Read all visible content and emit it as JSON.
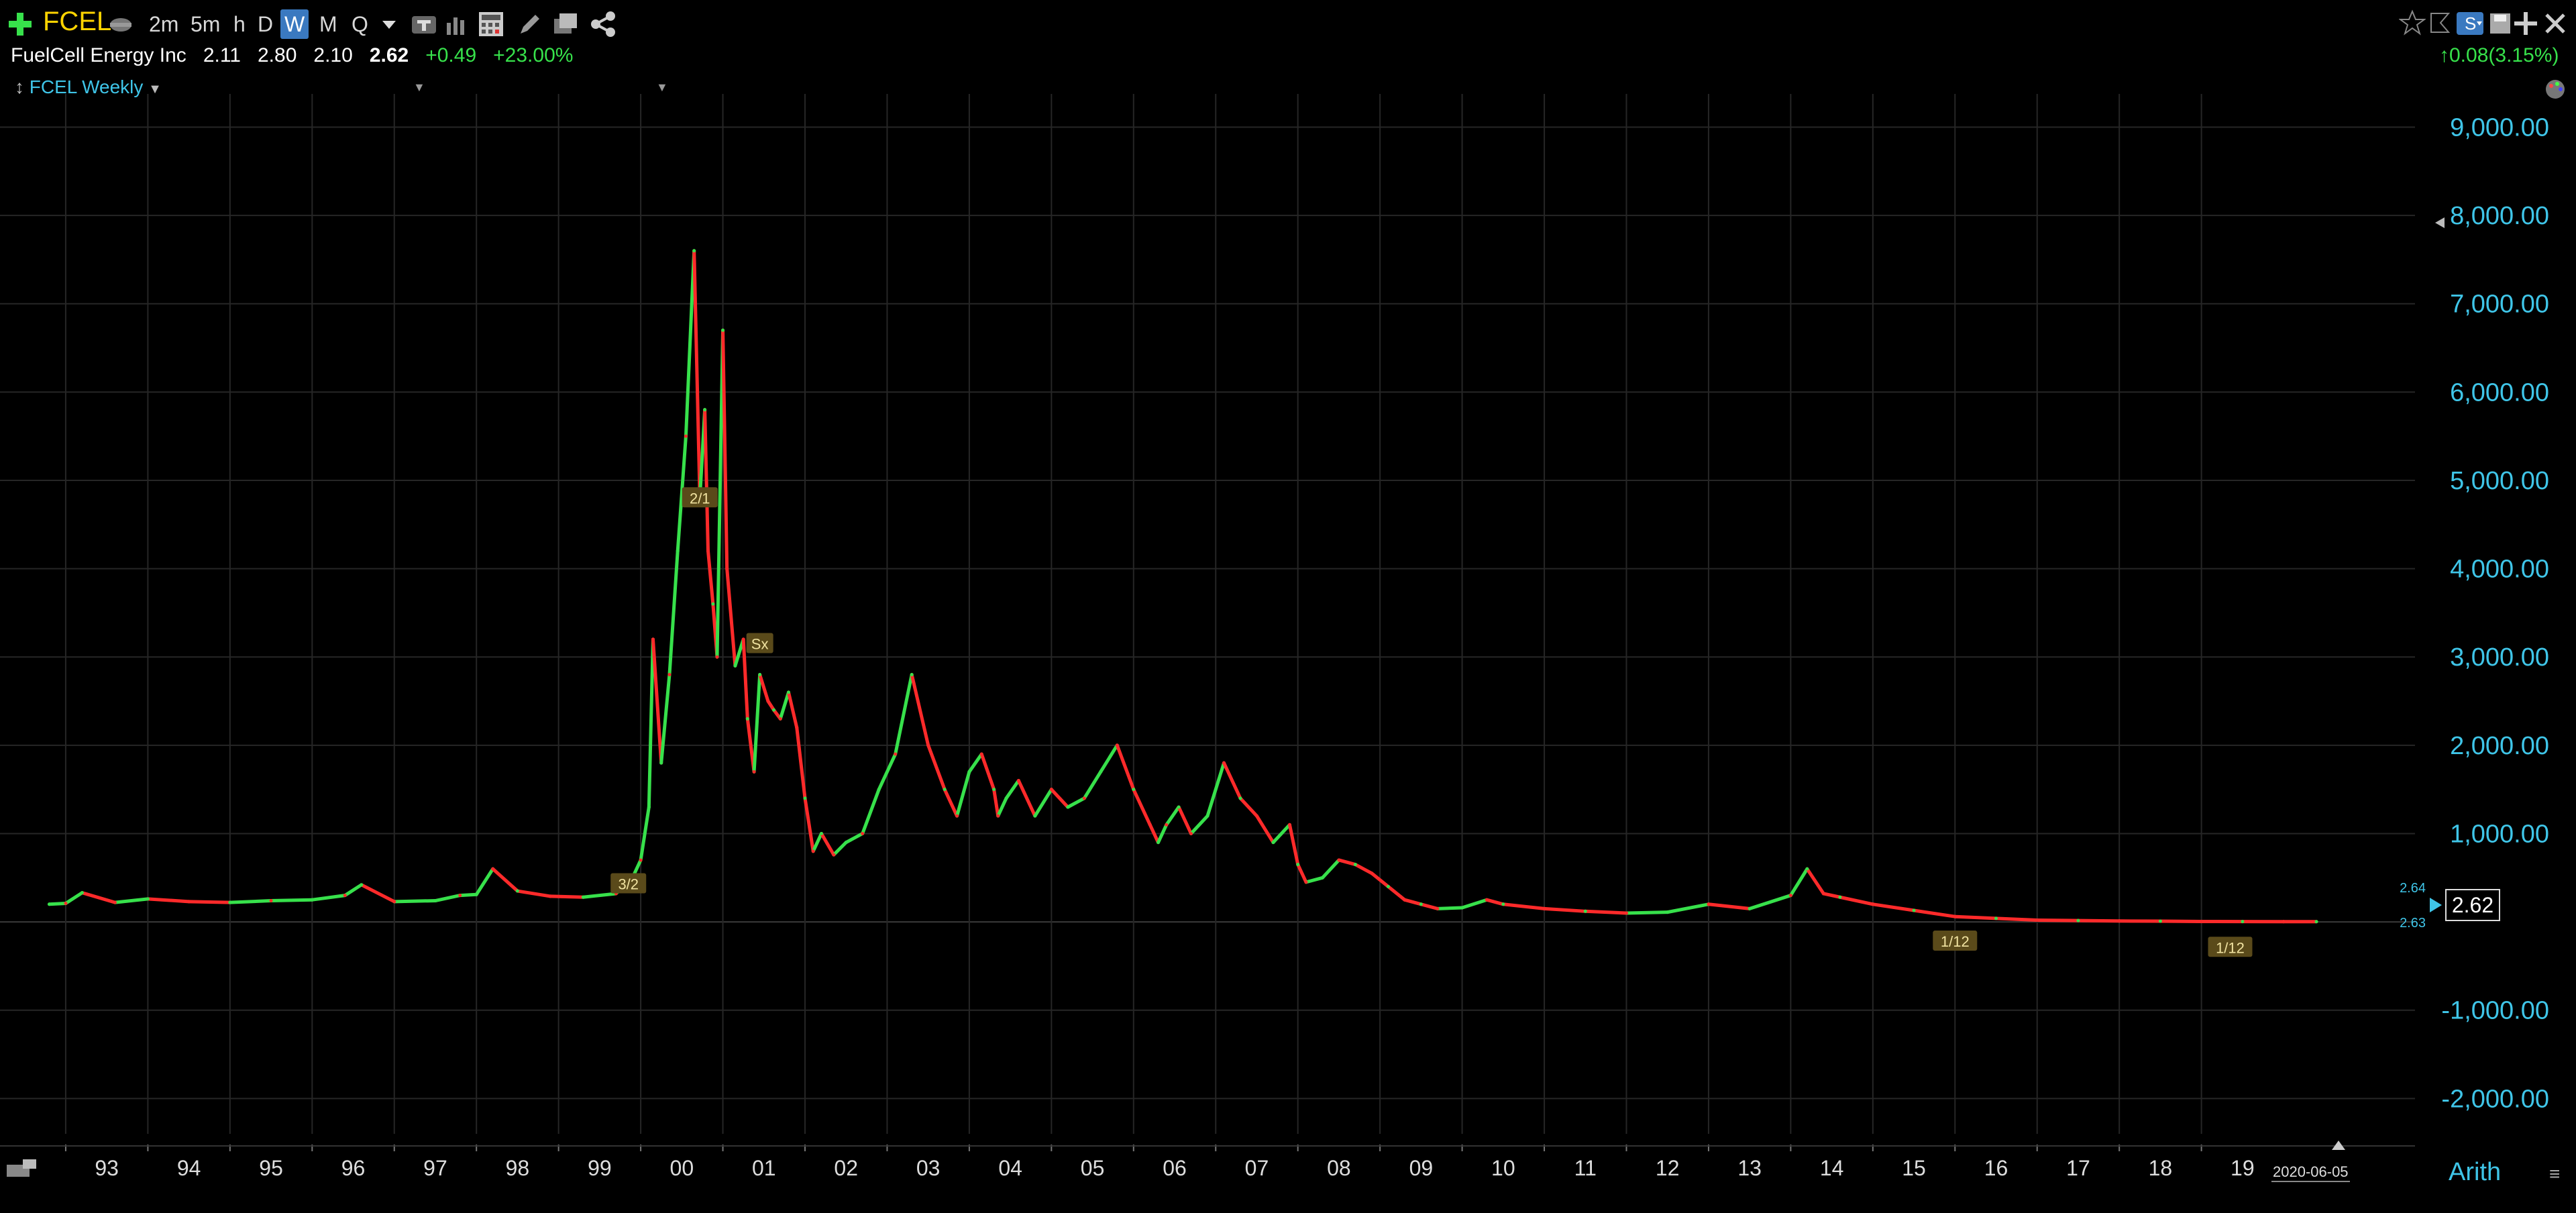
{
  "toolbar": {
    "symbol": "FCEL",
    "timeframes": [
      "2m",
      "5m",
      "h",
      "D",
      "W",
      "M",
      "Q"
    ],
    "active_timeframe": "W"
  },
  "quote": {
    "name": "FuelCell Energy Inc",
    "open": "2.11",
    "high": "2.80",
    "low": "2.10",
    "last": "2.62",
    "change": "+0.49",
    "change_pct": "+23.00%",
    "right_change": "0.08(3.15%)"
  },
  "chart_label": "FCEL Weekly",
  "scale_mode": "Arith",
  "date_marker": "2020-06-05",
  "colors": {
    "up": "#37e14b",
    "down": "#ff2a2a",
    "axis": "#3fc5e8",
    "grid": "#262626"
  },
  "chart_data": {
    "type": "line",
    "series": [
      {
        "x": [
          1992.8,
          1993.0,
          1993.2,
          1993.6,
          1994.0,
          1994.5,
          1995.0,
          1995.5,
          1996.0,
          1996.4,
          1996.6,
          1997.0,
          1997.5,
          1997.8,
          1998.0,
          1998.2,
          1998.5,
          1998.9,
          1999.3,
          1999.7,
          1999.9,
          2000.0,
          2000.1,
          2000.15,
          2000.25,
          2000.35,
          2000.45,
          2000.55,
          2000.65,
          2000.72,
          2000.78,
          2000.82,
          2000.88,
          2000.93,
          2001.0,
          2001.05,
          2001.15,
          2001.25,
          2001.3,
          2001.38,
          2001.45,
          2001.55,
          2001.62,
          2001.7,
          2001.8,
          2001.9,
          2002.0,
          2002.1,
          2002.2,
          2002.35,
          2002.5,
          2002.7,
          2002.9,
          2003.1,
          2003.3,
          2003.5,
          2003.7,
          2003.85,
          2004.0,
          2004.15,
          2004.3,
          2004.35,
          2004.45,
          2004.6,
          2004.8,
          2005.0,
          2005.2,
          2005.4,
          2005.6,
          2005.8,
          2006.0,
          2006.2,
          2006.3,
          2006.4,
          2006.55,
          2006.7,
          2006.9,
          2007.1,
          2007.3,
          2007.5,
          2007.7,
          2007.9,
          2008.0,
          2008.1,
          2008.3,
          2008.5,
          2008.7,
          2008.9,
          2009.1,
          2009.3,
          2009.5,
          2009.7,
          2010.0,
          2010.3,
          2010.5,
          2011.0,
          2011.5,
          2012.0,
          2012.5,
          2013.0,
          2013.5,
          2014.0,
          2014.2,
          2014.4,
          2014.6,
          2015.0,
          2015.5,
          2016.0,
          2016.5,
          2017.0,
          2017.5,
          2018.0,
          2018.5,
          2019.0,
          2019.5,
          2020.0,
          2020.4
        ],
        "y": [
          200,
          210,
          330,
          220,
          260,
          230,
          220,
          240,
          250,
          300,
          420,
          230,
          240,
          300,
          310,
          600,
          350,
          290,
          280,
          320,
          500,
          700,
          1300,
          3200,
          1800,
          2800,
          4200,
          5500,
          7600,
          4800,
          5800,
          4200,
          3600,
          3000,
          6700,
          4000,
          2900,
          3200,
          2300,
          1700,
          2800,
          2500,
          2400,
          2300,
          2600,
          2200,
          1400,
          800,
          1000,
          760,
          900,
          1000,
          1500,
          1900,
          2800,
          2000,
          1500,
          1200,
          1700,
          1900,
          1500,
          1200,
          1400,
          1600,
          1200,
          1500,
          1300,
          1400,
          1700,
          2000,
          1500,
          1100,
          900,
          1100,
          1300,
          1000,
          1200,
          1800,
          1400,
          1200,
          900,
          1100,
          650,
          450,
          500,
          700,
          650,
          550,
          400,
          250,
          200,
          150,
          160,
          250,
          200,
          150,
          120,
          100,
          110,
          200,
          150,
          300,
          600,
          320,
          280,
          200,
          130,
          60,
          40,
          20,
          15,
          10,
          8,
          5,
          4,
          3,
          2.62
        ]
      }
    ],
    "x_tick_labels": [
      "93",
      "94",
      "95",
      "96",
      "97",
      "98",
      "99",
      "00",
      "01",
      "02",
      "03",
      "04",
      "05",
      "06",
      "07",
      "08",
      "09",
      "10",
      "11",
      "12",
      "13",
      "14",
      "15",
      "16",
      "17",
      "18",
      "19"
    ],
    "y_tick_labels": [
      "9,000.00",
      "8,000.00",
      "7,000.00",
      "6,000.00",
      "5,000.00",
      "4,000.00",
      "3,000.00",
      "2,000.00",
      "1,000.00",
      "-1,000.00",
      "-2,000.00"
    ],
    "y_ticks": [
      9000,
      8000,
      7000,
      6000,
      5000,
      4000,
      3000,
      2000,
      1000,
      -1000,
      -2000
    ],
    "ylim": [
      -2400,
      9300
    ],
    "xlim": [
      1992.2,
      2021.6
    ],
    "annotations": [
      {
        "text": "3/2",
        "x": 1999.85,
        "y": 430
      },
      {
        "text": "2/1",
        "x": 2000.72,
        "y": 4800
      },
      {
        "text": "Sx",
        "x": 2001.45,
        "y": 3150
      },
      {
        "text": "1/12",
        "x": 2016.0,
        "y": -220
      },
      {
        "text": "1/12",
        "x": 2019.35,
        "y": -290
      }
    ],
    "price_label": "2.62",
    "price_high": "2.64",
    "price_low": "2.63",
    "grid": true
  }
}
